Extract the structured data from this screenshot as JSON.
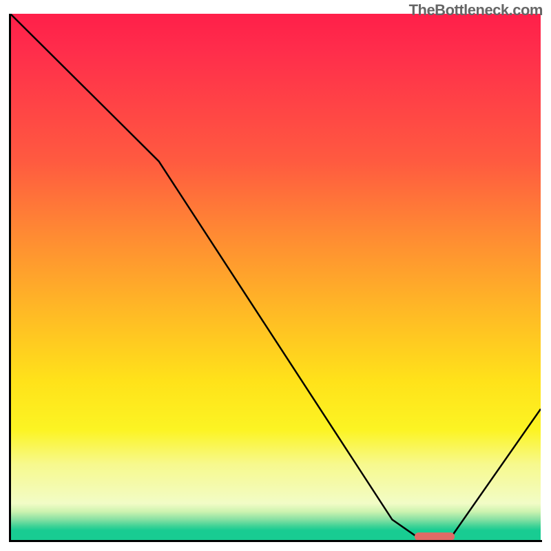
{
  "watermark": "TheBottleneck.com",
  "chart_data": {
    "type": "line",
    "title": "",
    "xlabel": "",
    "ylabel": "",
    "xlim": [
      0,
      100
    ],
    "ylim": [
      0,
      100
    ],
    "x": [
      0,
      22,
      28,
      72,
      77,
      83,
      100
    ],
    "values": [
      100,
      78,
      72,
      4,
      0.5,
      0.5,
      25
    ],
    "plateau": {
      "x_start": 77,
      "x_end": 83,
      "y": 0.5
    },
    "plateau_marker": {
      "color": "#df6b66",
      "thickness": 12
    },
    "background": {
      "gradient_stops": [
        {
          "pos": 0.0,
          "color": "#ff1f4a"
        },
        {
          "pos": 0.3,
          "color": "#ff5a40"
        },
        {
          "pos": 0.6,
          "color": "#ffb726"
        },
        {
          "pos": 0.85,
          "color": "#fcf423"
        },
        {
          "pos": 0.96,
          "color": "#86e0a3"
        },
        {
          "pos": 1.0,
          "color": "#18cc92"
        }
      ]
    }
  }
}
